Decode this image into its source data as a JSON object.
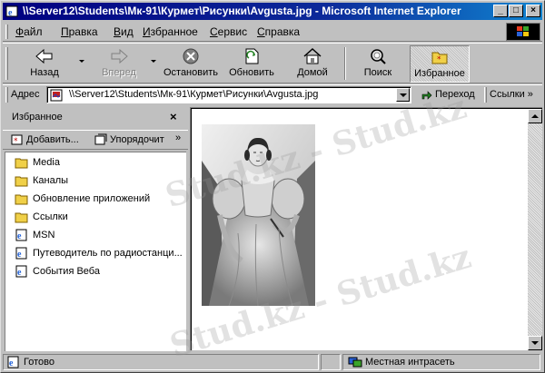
{
  "window": {
    "title": "\\\\Server12\\Students\\Мк-91\\Курмет\\Рисунки\\Avgusta.jpg - Microsoft Internet Explorer"
  },
  "menu": [
    {
      "label": "Файл",
      "key": "Ф",
      "rest": "айл"
    },
    {
      "label": "Правка",
      "key": "П",
      "rest": "равка"
    },
    {
      "label": "Вид",
      "key": "В",
      "rest": "ид"
    },
    {
      "label": "Избранное",
      "key": "И",
      "rest": "збранное"
    },
    {
      "label": "Сервис",
      "key": "С",
      "rest": "ервис"
    },
    {
      "label": "Справка",
      "key": "С",
      "rest": "правка"
    }
  ],
  "toolbar": {
    "back": "Назад",
    "forward": "Вперед",
    "stop": "Остановить",
    "refresh": "Обновить",
    "home": "Домой",
    "search": "Поиск",
    "favorites": "Избранное"
  },
  "address": {
    "label": "Адрес",
    "value": "\\\\Server12\\Students\\Мк-91\\Курмет\\Рисунки\\Avgusta.jpg",
    "go": "Переход",
    "links": "Ссылки"
  },
  "favorites_pane": {
    "title": "Избранное",
    "add": "Добавить...",
    "organize": "Упорядочит",
    "items": [
      {
        "label": "Media",
        "icon": "folder-icon"
      },
      {
        "label": "Каналы",
        "icon": "folder-icon"
      },
      {
        "label": "Обновление приложений",
        "icon": "folder-icon"
      },
      {
        "label": "Ссылки",
        "icon": "folder-icon"
      },
      {
        "label": "MSN",
        "icon": "ie-page-icon"
      },
      {
        "label": "Путеводитель по радиостанци...",
        "icon": "ie-page-icon"
      },
      {
        "label": "События Веба",
        "icon": "ie-page-icon"
      }
    ]
  },
  "status": {
    "text": "Готово",
    "zone": "Местная интрасеть"
  },
  "watermark": {
    "text": "Stud.kz - Stud.kz"
  },
  "colors": {
    "titlebar_start": "#000080",
    "titlebar_end": "#1084d0",
    "face": "#c0c0c0"
  }
}
